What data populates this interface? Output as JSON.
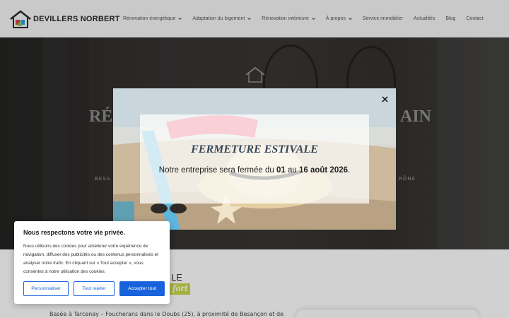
{
  "header": {
    "logo_text": "DEVILLERS NORBERT",
    "nav": [
      {
        "label": "Rénovation énergétique",
        "has_dropdown": true
      },
      {
        "label": "Adaptation du logement",
        "has_dropdown": true
      },
      {
        "label": "Rénovation intérieure",
        "has_dropdown": true
      },
      {
        "label": "À propos",
        "has_dropdown": true
      },
      {
        "label": "Service immobilier",
        "has_dropdown": false
      },
      {
        "label": "Actualités",
        "has_dropdown": false
      },
      {
        "label": "Blog",
        "has_dropdown": false
      },
      {
        "label": "Contact",
        "has_dropdown": false
      }
    ]
  },
  "hero": {
    "title_left": "RÉ",
    "title_right": "AIN",
    "subtitle_left": "BESA",
    "subtitle_right": "RÔNE"
  },
  "section": {
    "heading_1": "LE",
    "heading_2": "fort",
    "body_text": "Basée à Tarcenay – Foucherans dans le Doubs (25), à proximité de Besançon et de"
  },
  "modal": {
    "title": "FERMETURE ESTIVALE",
    "text_before": "Notre entreprise sera fermée du ",
    "text_bold_1": "01",
    "text_mid": " au ",
    "text_bold_2": "16 août 2026",
    "text_after": "."
  },
  "cookie": {
    "title": "Nous respectons votre vie privée.",
    "body": "Nous utilisons des cookies pour améliorer votre expérience de navigation, diffuser des publicités ou des contenus personnalisés et analyser notre trafic. En cliquant sur « Tout accepter », vous consentez à notre utilisation des cookies.",
    "btn_customize": "Personnaliser",
    "btn_reject": "Tout rejeter",
    "btn_accept": "Accepter tout"
  },
  "colors": {
    "accent_blue": "#1863dc",
    "highlight_green": "#c9d84a",
    "modal_title": "#38485a"
  },
  "icons": [
    "house-logo-icon",
    "chevron-down-icon",
    "close-icon",
    "hero-house-icon"
  ]
}
